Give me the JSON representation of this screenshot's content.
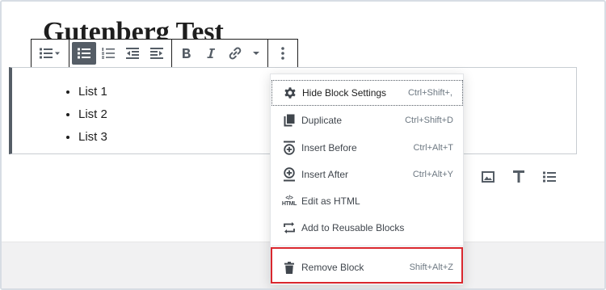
{
  "editor": {
    "post_title": "Gutenberg Test",
    "list_items": [
      "List 1",
      "List 2",
      "List 3"
    ]
  },
  "toolbar": {
    "groups": [
      [
        "list-type-dropdown"
      ],
      [
        "unordered-list",
        "ordered-list",
        "outdent",
        "indent"
      ],
      [
        "bold",
        "italic",
        "link",
        "more-formatting"
      ],
      [
        "more-options"
      ]
    ],
    "active_button": "unordered-list"
  },
  "inserter_icons": [
    "image-icon",
    "heading-icon",
    "list-icon"
  ],
  "more_menu": {
    "items": [
      {
        "icon": "gear-icon",
        "label": "Hide Block Settings",
        "shortcut": "Ctrl+Shift+,"
      },
      {
        "icon": "duplicate-icon",
        "label": "Duplicate",
        "shortcut": "Ctrl+Shift+D"
      },
      {
        "icon": "insert-before-icon",
        "label": "Insert Before",
        "shortcut": "Ctrl+Alt+T"
      },
      {
        "icon": "insert-after-icon",
        "label": "Insert After",
        "shortcut": "Ctrl+Alt+Y"
      },
      {
        "icon": "html-icon",
        "label": "Edit as HTML",
        "shortcut": ""
      },
      {
        "icon": "reusable-block-icon",
        "label": "Add to Reusable Blocks",
        "shortcut": ""
      },
      {
        "icon": "trash-icon",
        "label": "Remove Block",
        "shortcut": "Shift+Alt+Z"
      }
    ],
    "html_icon_text": "HTML",
    "highlighted_item": "Remove Block"
  },
  "colors": {
    "toolbar_active_bg": "#555d66",
    "highlight_border": "#d9272e",
    "icon_gray": "#555d66"
  }
}
